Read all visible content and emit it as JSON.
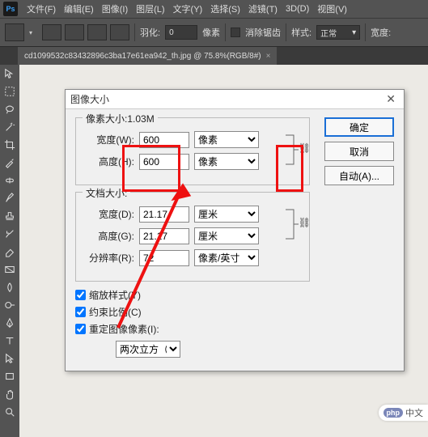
{
  "menubar": {
    "items": [
      "文件(F)",
      "编辑(E)",
      "图像(I)",
      "图层(L)",
      "文字(Y)",
      "选择(S)",
      "滤镜(T)",
      "3D(D)",
      "视图(V)"
    ]
  },
  "optbar": {
    "feather_label": "羽化:",
    "feather_value": "0",
    "feather_unit": "像素",
    "antialias_label": "消除锯齿",
    "style_label": "样式:",
    "style_value": "正常",
    "width_label": "宽度:"
  },
  "tab": {
    "title": "cd1099532c83432896c3ba17e61ea942_th.jpg @ 75.8%(RGB/8#)"
  },
  "dialog": {
    "title": "图像大小",
    "pixel_size_label": "像素大小:1.03M",
    "width_label": "宽度(W):",
    "width_value": "600",
    "height_label": "高度(H):",
    "height_value": "600",
    "px_unit": "像素",
    "doc_size_label": "文档大小:",
    "doc_width_label": "宽度(D):",
    "doc_width_value": "21.17",
    "doc_height_label": "高度(G):",
    "doc_height_value": "21.17",
    "cm_unit": "厘米",
    "res_label": "分辨率(R):",
    "res_value": "72",
    "res_unit": "像素/英寸",
    "scale_styles": "缩放样式(Y)",
    "constrain": "约束比例(C)",
    "resample": "重定图像像素(I):",
    "resample_method": "两次立方（自动）",
    "ok": "确定",
    "cancel": "取消",
    "auto": "自动(A)..."
  },
  "watermark": {
    "php": "php",
    "text": "中文"
  }
}
